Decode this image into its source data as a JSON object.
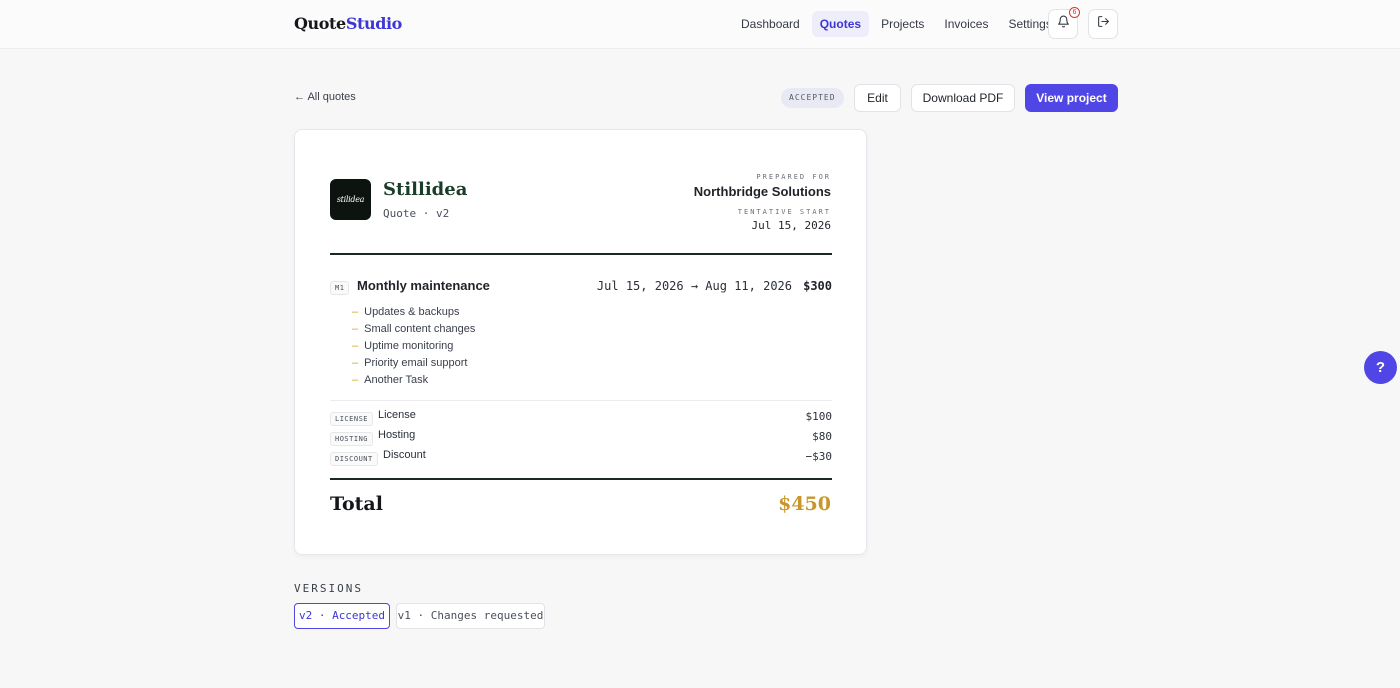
{
  "app": {
    "logo_part1": "Quote",
    "logo_part2": "Studio"
  },
  "nav": {
    "items": [
      "Dashboard",
      "Quotes",
      "Projects",
      "Invoices",
      "Settings"
    ],
    "active": "Quotes",
    "notification_count": "6",
    "icons": [
      "bell-icon",
      "logout-icon"
    ]
  },
  "toolbar": {
    "back_label": "← All quotes",
    "status": "ACCEPTED",
    "edit_label": "Edit",
    "download_label": "Download PDF",
    "view_project_label": "View project"
  },
  "quote": {
    "brand_name": "Stillidea",
    "logo_text": "stilidea",
    "subtitle": "Quote · v2",
    "prepared_for_label": "PREPARED FOR",
    "client_name": "Northbridge Solutions",
    "tentative_start_label": "TENTATIVE START",
    "tentative_start_date": "Jul 15, 2026",
    "milestone": {
      "tag": "M1",
      "title": "Monthly maintenance",
      "dates": "Jul 15, 2026 → Aug 11, 2026",
      "price": "$300",
      "tasks": [
        "Updates & backups",
        "Small content changes",
        "Uptime monitoring",
        "Priority email support",
        "Another Task"
      ]
    },
    "line_items": [
      {
        "tag": "LICENSE",
        "label": "License",
        "amount": "$100"
      },
      {
        "tag": "HOSTING",
        "label": "Hosting",
        "amount": "$80"
      },
      {
        "tag": "DISCOUNT",
        "label": "Discount",
        "amount": "−$30"
      }
    ],
    "total_label": "Total",
    "total_amount": "$450"
  },
  "versions": {
    "title": "VERSIONS",
    "items": [
      {
        "label": "v2 · Accepted",
        "active": true
      },
      {
        "label": "v1 · Changes requested",
        "active": false
      }
    ]
  },
  "help": {
    "label": "?"
  },
  "colors": {
    "accent": "#4f46e5",
    "brand_green": "#1a3d2a",
    "total_gold": "#c9962a",
    "task_dash": "#d4a017"
  }
}
